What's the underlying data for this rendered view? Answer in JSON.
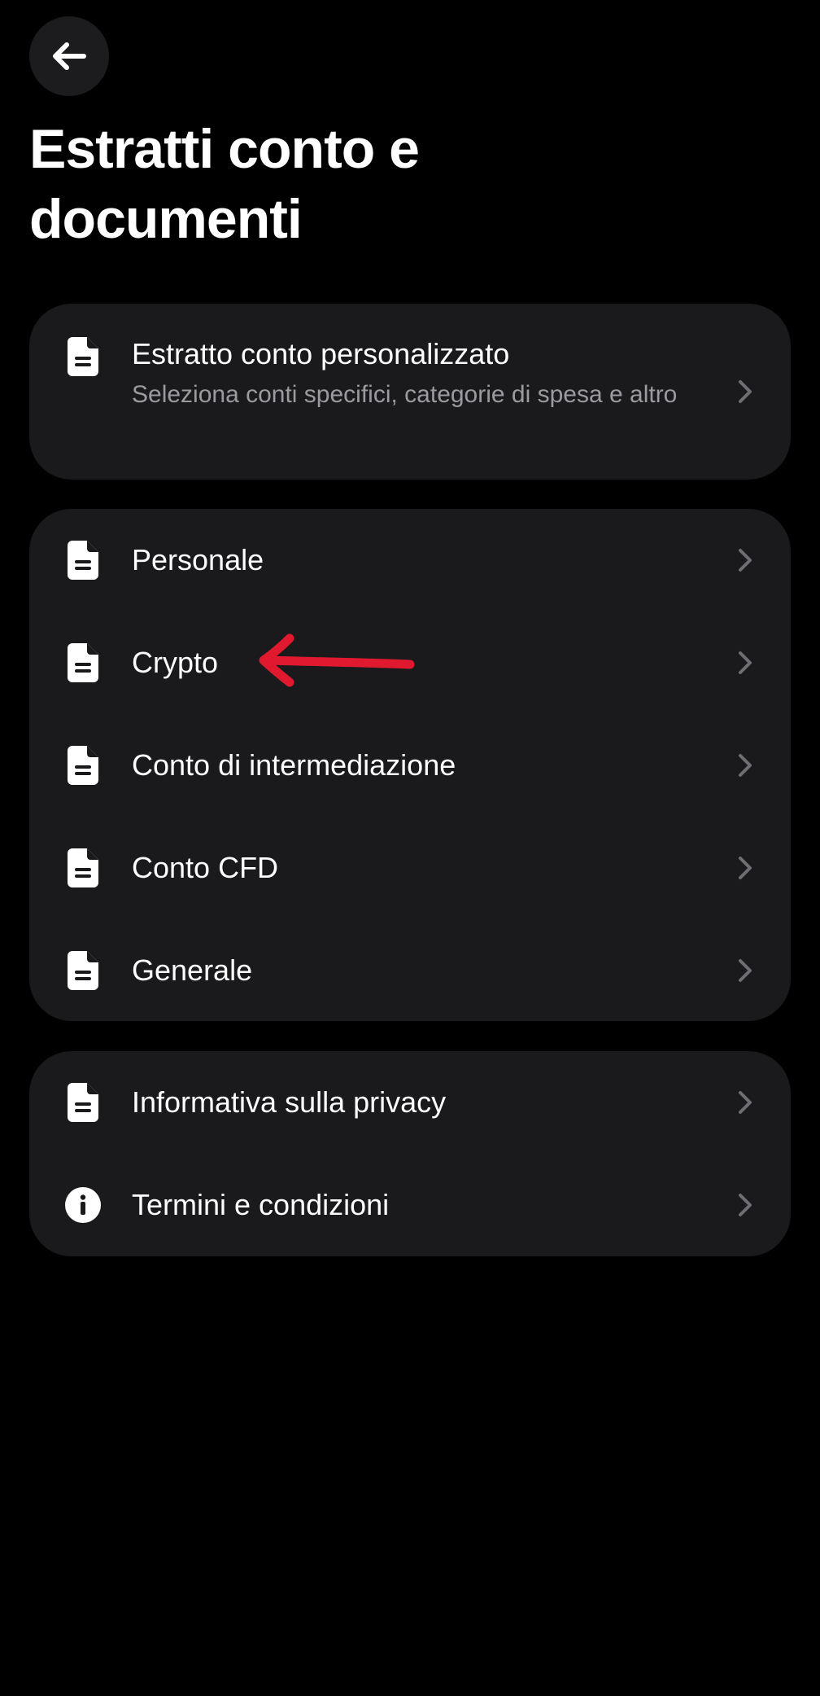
{
  "header": {
    "back_icon": "arrow-left-icon",
    "title": "Estratti conto e documenti"
  },
  "custom_statement": {
    "icon": "document-icon",
    "title": "Estratto conto personalizzato",
    "subtitle": "Seleziona conti specifici, categorie di spesa e altro"
  },
  "accounts": [
    {
      "icon": "document-icon",
      "label": "Personale"
    },
    {
      "icon": "document-icon",
      "label": "Crypto"
    },
    {
      "icon": "document-icon",
      "label": "Conto di intermediazione"
    },
    {
      "icon": "document-icon",
      "label": "Conto CFD"
    },
    {
      "icon": "document-icon",
      "label": "Generale"
    }
  ],
  "legal": [
    {
      "icon": "document-icon",
      "label": "Informativa sulla privacy"
    },
    {
      "icon": "info-icon",
      "label": "Termini e condizioni"
    }
  ],
  "colors": {
    "background": "#000000",
    "card": "#1a1a1c",
    "text_primary": "#ffffff",
    "text_secondary": "#9a9a9f",
    "chevron": "#6e6e73",
    "annotation_arrow": "#e0192f"
  }
}
